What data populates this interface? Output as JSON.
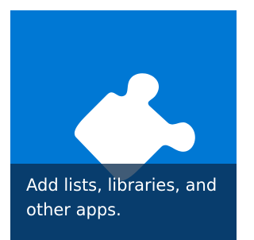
{
  "tile": {
    "caption": "Add lists, libraries, and other apps.",
    "icon": "puzzle-piece-icon",
    "background_color": "#0078d4",
    "caption_background_color": "#0b2e4f",
    "icon_color": "#ffffff"
  }
}
